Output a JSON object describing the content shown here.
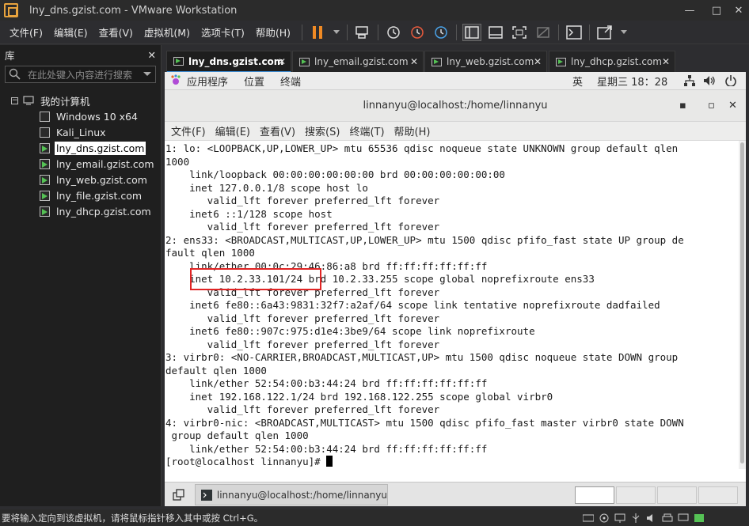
{
  "window": {
    "title": "lny_dns.gzist.com - VMware Workstation",
    "minimize": "—",
    "maximize": "□",
    "close": "✕"
  },
  "menu": [
    "文件(F)",
    "编辑(E)",
    "查看(V)",
    "虚拟机(M)",
    "选项卡(T)",
    "帮助(H)"
  ],
  "library": {
    "title": "库",
    "close": "✕",
    "search_placeholder": "在此处键入内容进行搜索",
    "root": "我的计算机",
    "items": [
      {
        "label": "Windows 10 x64",
        "running": false
      },
      {
        "label": "Kali_Linux",
        "running": false
      },
      {
        "label": "lny_dns.gzist.com",
        "running": true,
        "selected": true
      },
      {
        "label": "lny_email.gzist.com",
        "running": true
      },
      {
        "label": "lny_web.gzist.com",
        "running": true
      },
      {
        "label": "lny_file.gzist.com",
        "running": true
      },
      {
        "label": "lny_dhcp.gzist.com",
        "running": true
      }
    ]
  },
  "tabs": [
    {
      "label": "lny_dns.gzist.com",
      "active": true
    },
    {
      "label": "lny_email.gzist.com"
    },
    {
      "label": "lny_web.gzist.com"
    },
    {
      "label": "lny_dhcp.gzist.com"
    }
  ],
  "gnome": {
    "applications": "应用程序",
    "places": "位置",
    "terminal": "终端",
    "lang": "英",
    "clock": "星期三 18：28"
  },
  "terminal": {
    "title": "linnanyu@localhost:/home/linnanyu",
    "menu": [
      "文件(F)",
      "编辑(E)",
      "查看(V)",
      "搜索(S)",
      "终端(T)",
      "帮助(H)"
    ],
    "lines": [
      "1: lo: <LOOPBACK,UP,LOWER_UP> mtu 65536 qdisc noqueue state UNKNOWN group default qlen",
      "1000",
      "    link/loopback 00:00:00:00:00:00 brd 00:00:00:00:00:00",
      "    inet 127.0.0.1/8 scope host lo",
      "       valid_lft forever preferred_lft forever",
      "    inet6 ::1/128 scope host",
      "       valid_lft forever preferred_lft forever",
      "2: ens33: <BROADCAST,MULTICAST,UP,LOWER_UP> mtu 1500 qdisc pfifo_fast state UP group de",
      "fault qlen 1000",
      "    link/ether 00:0c:29:46:86:a8 brd ff:ff:ff:ff:ff:ff",
      "    inet 10.2.33.101/24 brd 10.2.33.255 scope global noprefixroute ens33",
      "       valid_lft forever preferred_lft forever",
      "    inet6 fe80::6a43:9831:32f7:a2af/64 scope link tentative noprefixroute dadfailed",
      "       valid_lft forever preferred_lft forever",
      "    inet6 fe80::907c:975:d1e4:3be9/64 scope link noprefixroute",
      "       valid_lft forever preferred_lft forever",
      "3: virbr0: <NO-CARRIER,BROADCAST,MULTICAST,UP> mtu 1500 qdisc noqueue state DOWN group",
      "default qlen 1000",
      "    link/ether 52:54:00:b3:44:24 brd ff:ff:ff:ff:ff:ff",
      "    inet 192.168.122.1/24 brd 192.168.122.255 scope global virbr0",
      "       valid_lft forever preferred_lft forever",
      "4: virbr0-nic: <BROADCAST,MULTICAST> mtu 1500 qdisc pfifo_fast master virbr0 state DOWN",
      " group default qlen 1000",
      "    link/ether 52:54:00:b3:44:24 brd ff:ff:ff:ff:ff:ff"
    ],
    "prompt": "[root@localhost linnanyu]# "
  },
  "taskbar": {
    "window_label": "linnanyu@localhost:/home/linnanyu"
  },
  "statusbar": {
    "text": "要将输入定向到该虚拟机，请将鼠标指针移入其中或按 Ctrl+G。"
  },
  "colors": {
    "highlight": "#e02424",
    "running": "#55c255",
    "accent": "#3c8ed8"
  }
}
